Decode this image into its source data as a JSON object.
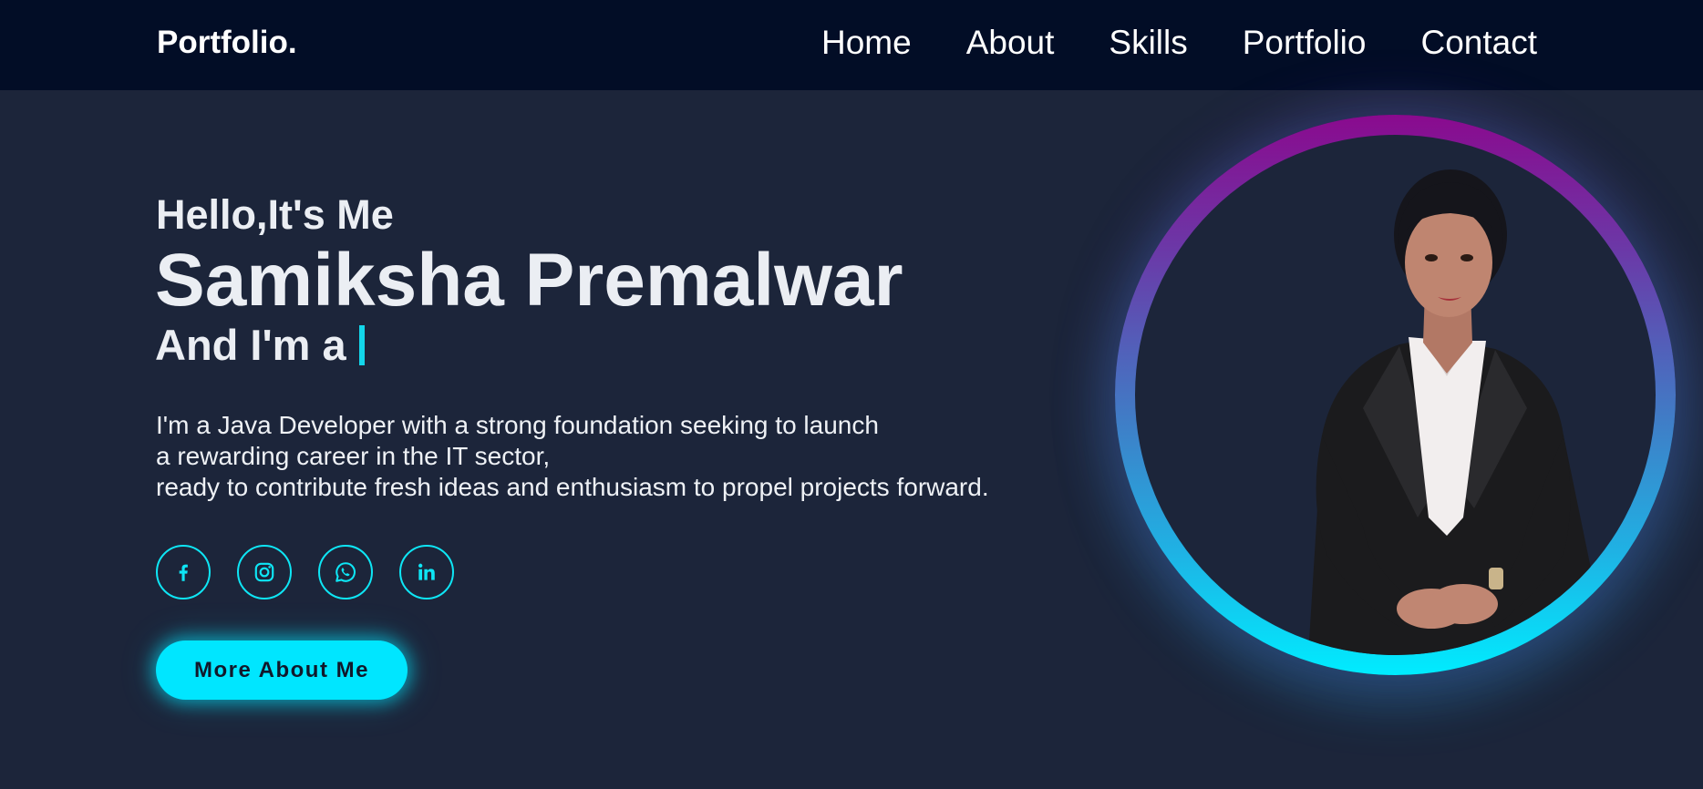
{
  "nav": {
    "logo": "Portfolio.",
    "links": [
      "Home",
      "About",
      "Skills",
      "Portfolio",
      "Contact"
    ]
  },
  "hero": {
    "greeting": "Hello,It's Me",
    "name": "Samiksha Premalwar",
    "role_prefix": "And I'm a",
    "description": [
      "I'm a Java Developer with a strong foundation seeking to launch",
      "a rewarding career in the IT sector,",
      "ready to contribute fresh ideas and enthusiasm to propel projects forward."
    ],
    "socials": [
      {
        "icon": "facebook-icon"
      },
      {
        "icon": "instagram-icon"
      },
      {
        "icon": "whatsapp-icon"
      },
      {
        "icon": "linkedin-icon"
      }
    ],
    "cta_label": "More About Me"
  },
  "colors": {
    "nav_bg": "#020d26",
    "page_bg": "#1c253a",
    "accent": "#00e6ff",
    "ring_top": "#8a0a8e",
    "ring_bottom": "#00ecff"
  }
}
